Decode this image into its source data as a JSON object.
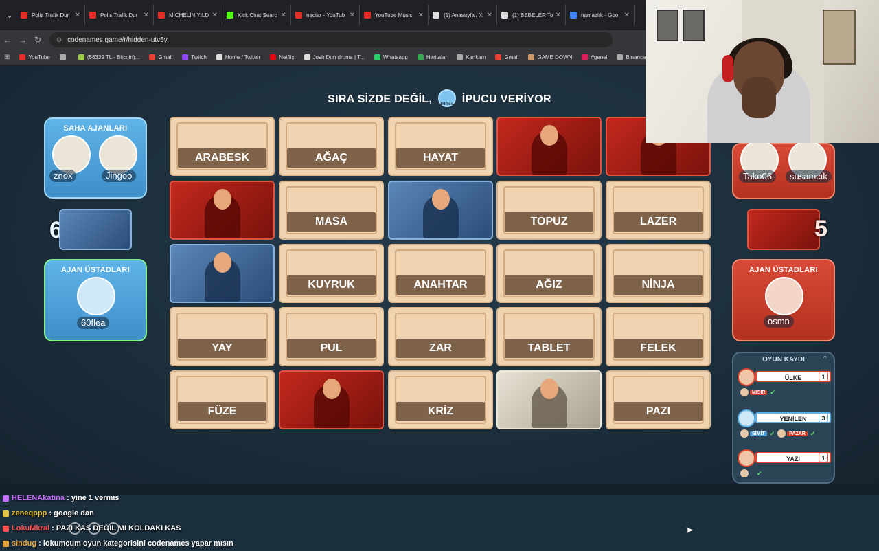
{
  "browser": {
    "tabs": [
      {
        "title": "Polis Trafik Dur",
        "color": "#e52d27"
      },
      {
        "title": "Polis Trafik Dur",
        "color": "#e52d27"
      },
      {
        "title": "MİCHELİN YILD",
        "color": "#e52d27"
      },
      {
        "title": "Kick Chat Searc",
        "color": "#53fc18"
      },
      {
        "title": "nectar - YouTub",
        "color": "#e52d27"
      },
      {
        "title": "YouTube Music",
        "color": "#e52d27"
      },
      {
        "title": "(1) Anasayfa / X",
        "color": "#dddddd"
      },
      {
        "title": "(1) BEBELER To",
        "color": "#dddddd"
      },
      {
        "title": "namazlık - Goo",
        "color": "#4285f4"
      }
    ],
    "url": "codenames.game/r/hidden-utv5y",
    "bookmarks": [
      {
        "label": "YouTube",
        "color": "#e52d27"
      },
      {
        "label": "",
        "color": "#aaaaaa"
      },
      {
        "label": "(56339 TL - Bitcoin)...",
        "color": "#9ac943"
      },
      {
        "label": "Gmail",
        "color": "#ea4335"
      },
      {
        "label": "Twitch",
        "color": "#9146ff"
      },
      {
        "label": "Home / Twitter",
        "color": "#dddddd"
      },
      {
        "label": "Netflix",
        "color": "#e50914"
      },
      {
        "label": "Josh Dun drums | T...",
        "color": "#dddddd"
      },
      {
        "label": "Whatsapp",
        "color": "#25d366"
      },
      {
        "label": "Haritalar",
        "color": "#34a853"
      },
      {
        "label": "Kankam",
        "color": "#aaaaaa"
      },
      {
        "label": "Gmail",
        "color": "#ea4335"
      },
      {
        "label": "GAME DOWN",
        "color": "#cc9966"
      },
      {
        "label": "#genel",
        "color": "#e01e5a"
      },
      {
        "label": "Binance",
        "color": "#aaaaaa"
      }
    ]
  },
  "game": {
    "turn_text_left": "SIRA SİZDE DEĞİL,",
    "turn_avatar_name": "60flea",
    "turn_text_right": "İPUCU VERİYOR",
    "blue": {
      "operatives_title": "SAHA AJANLARI",
      "operatives": [
        "znox",
        "Jingoo"
      ],
      "score": "6",
      "spymasters_title": "AJAN ÜSTADLARI",
      "spymaster": "60flea"
    },
    "red": {
      "operatives": [
        "Tako06",
        "susamcık"
      ],
      "score": "5",
      "spymasters_title": "AJAN ÜSTADLARI",
      "spymaster": "osmn"
    },
    "board": [
      {
        "type": "word",
        "text": "ARABESK"
      },
      {
        "type": "word",
        "text": "AĞAÇ"
      },
      {
        "type": "word",
        "text": "HAYAT"
      },
      {
        "type": "red",
        "text": ""
      },
      {
        "type": "red",
        "text": ""
      },
      {
        "type": "red",
        "text": ""
      },
      {
        "type": "word",
        "text": "MASA"
      },
      {
        "type": "blue",
        "text": ""
      },
      {
        "type": "word",
        "text": "TOPUZ"
      },
      {
        "type": "word",
        "text": "LAZER"
      },
      {
        "type": "blue",
        "text": ""
      },
      {
        "type": "word",
        "text": "KUYRUK"
      },
      {
        "type": "word",
        "text": "ANAHTAR"
      },
      {
        "type": "word",
        "text": "AĞIZ"
      },
      {
        "type": "word",
        "text": "NİNJA"
      },
      {
        "type": "word",
        "text": "YAY"
      },
      {
        "type": "word",
        "text": "PUL"
      },
      {
        "type": "word",
        "text": "ZAR"
      },
      {
        "type": "word",
        "text": "TABLET"
      },
      {
        "type": "word",
        "text": "FELEK"
      },
      {
        "type": "word",
        "text": "FÜZE"
      },
      {
        "type": "red",
        "text": ""
      },
      {
        "type": "word",
        "text": "KRİZ"
      },
      {
        "type": "bystander",
        "text": ""
      },
      {
        "type": "word",
        "text": "PAZI"
      }
    ],
    "log": {
      "title": "OYUN KAYDI",
      "clues": [
        {
          "team": "red",
          "giver": "osmn",
          "word": "ÜLKE",
          "number": "1",
          "guesses": [
            {
              "word": "MISIR",
              "team": "red"
            }
          ]
        },
        {
          "team": "blue",
          "giver": "60flea",
          "word": "YENİLEN",
          "number": "3",
          "guesses": [
            {
              "word": "SİMİT",
              "team": "blue"
            },
            {
              "word": "PAZAR",
              "team": "red"
            }
          ]
        },
        {
          "team": "red",
          "giver": "osmn",
          "word": "YAZI",
          "number": "1",
          "guesses": [
            {
              "word": "",
              "team": "red"
            }
          ]
        }
      ]
    }
  },
  "chat": [
    {
      "user": "HELENAkatina",
      "color": "#c66bff",
      "message": ": yine 1 vermis"
    },
    {
      "user": "zeneqppp",
      "color": "#e6c64a",
      "message": ": google dan"
    },
    {
      "user": "LokuMkral",
      "color": "#ff4d4d",
      "message": ": PAZI KAS DEĞIL MI KOLDAKI KAS"
    },
    {
      "user": "sindug",
      "color": "#e6a53a",
      "message": ": lokumcum oyun kategorisini codenames yapar mısın"
    }
  ],
  "colors": {
    "red_team": "#c8321f",
    "blue_team": "#4fa3dc",
    "word_card": "#f0d3b0",
    "word_label": "#7e6249"
  }
}
